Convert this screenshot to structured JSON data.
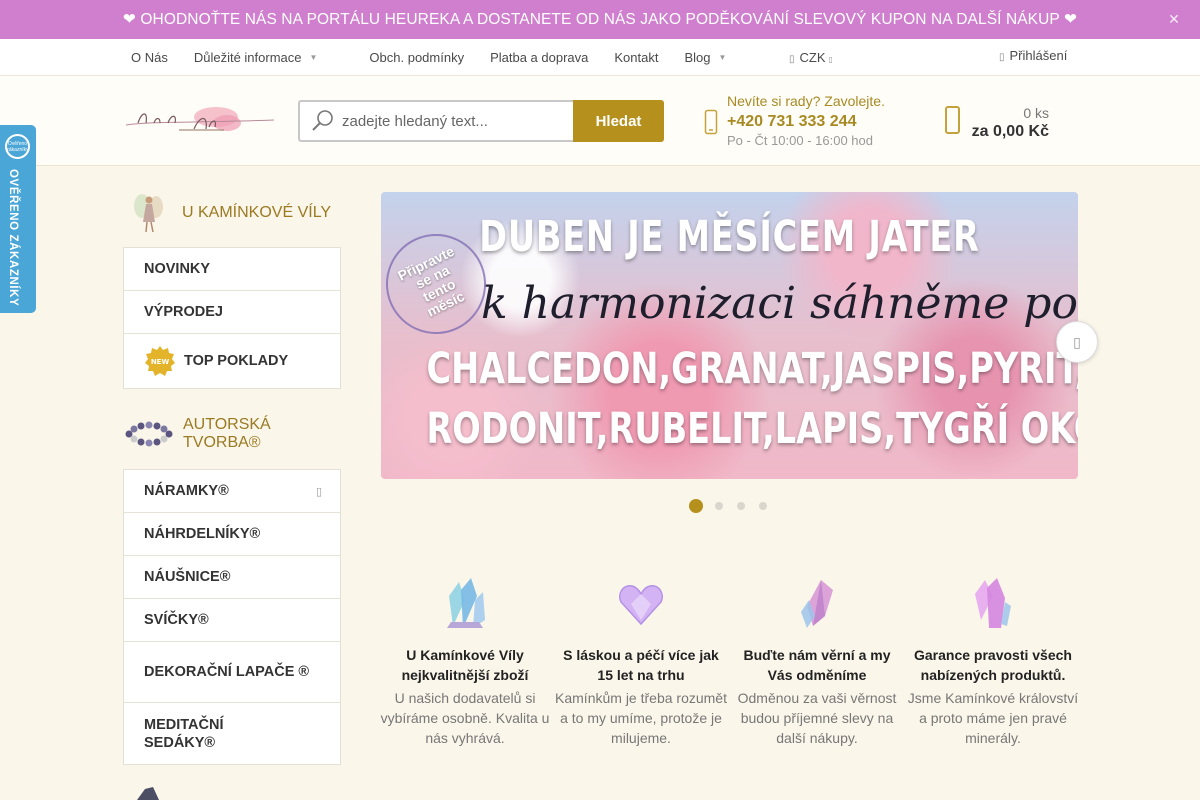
{
  "promo": {
    "text": "❤ OHODNOŤTE NÁS NA PORTÁLU HEUREKA A DOSTANETE OD NÁS JAKO PODĚKOVÁNÍ SLEVOVÝ KUPON NA DALŠÍ NÁKUP ❤"
  },
  "nav": {
    "links": [
      "O Nás",
      "Důležité informace",
      "Obch. podmínky",
      "Platba a doprava",
      "Kontakt",
      "Blog"
    ],
    "currency": "CZK",
    "login": "Přihlášení"
  },
  "search": {
    "placeholder": "zadejte hledaný text...",
    "button": "Hledat"
  },
  "help": {
    "question": "Nevíte si rady? Zavolejte.",
    "phone": "+420 731 333 244",
    "hours": "Po - Čt 10:00 - 16:00 hod"
  },
  "cart": {
    "count": "0 ks",
    "total": "za 0,00 Kč"
  },
  "verified": {
    "text": "OVĚŘENO ZÁKAZNÍKY",
    "badge": "Ověřeno zákazníky"
  },
  "sidebar": {
    "section1_title": "U KAMÍNKOVÉ VÍLY",
    "section1_items": [
      "NOVINKY",
      "VÝPRODEJ",
      "TOP POKLADY"
    ],
    "new_badge": "NEW",
    "section2_title_line1": "AUTORSKÁ",
    "section2_title_line2": "TVORBA®",
    "section2_items": [
      "NÁRAMKY®",
      "NÁHRDELNÍKY®",
      "NÁUŠNICE®",
      "SVÍČKY®",
      "DEKORAČNÍ LAPAČE ®",
      "MEDITAČNÍ SEDÁKY®"
    ]
  },
  "banner": {
    "line1": "DUBEN JE MĚSÍCEM JATER",
    "line2": "k harmonizaci sáhněme po",
    "line3": "CHALCEDON,GRANAT,JASPIS,PYRIT,RUBÍN",
    "line4": "RODONIT,RUBELIT,LAPIS,TYGŘÍ OKO,OLIVÍN",
    "stamp": "Připravte se na tento měsíc",
    "slides": 4,
    "active_slide": 1
  },
  "features": [
    {
      "title": "U Kamínkové Víly nejkvalitnější zboží",
      "desc": "U našich dodavatelů si vybíráme osobně. Kvalita u nás vyhrává.",
      "color": "#7fc7d9"
    },
    {
      "title": "S láskou a péčí více jak 15 let na trhu",
      "desc": "Kamínkům je třeba rozumět a to my umíme, protože je milujeme.",
      "color": "#c79be6"
    },
    {
      "title": "Buďte nám věrní a my Vás odměníme",
      "desc": "Odměnou za vaši věrnost budou příjemné slevy na další nákupy.",
      "color": "#d38fc7"
    },
    {
      "title": "Garance pravosti všech nabízených produktů.",
      "desc": "Jsme Kamínkové království a proto máme jen pravé minerály.",
      "color": "#d59ae0"
    }
  ],
  "colors": {
    "accent": "#b6901c",
    "promo": "#cf7fce",
    "verified": "#49a6d6"
  }
}
